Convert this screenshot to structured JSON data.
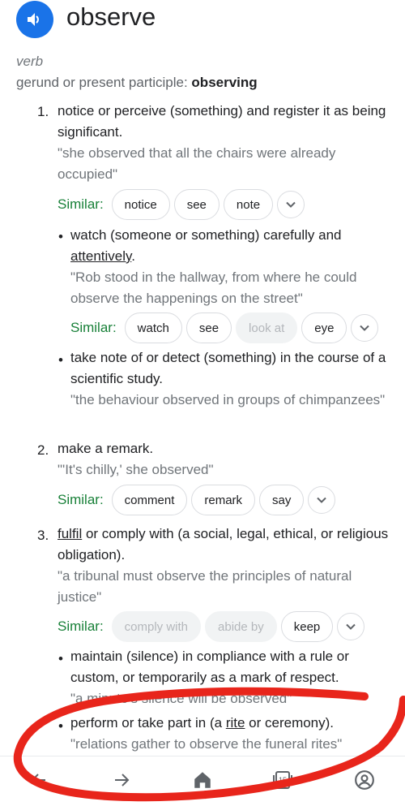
{
  "header": {
    "word": "observe",
    "speaker_icon": "volume-icon",
    "accent": "#1a73e8"
  },
  "pos": "verb",
  "gerund": {
    "label": "gerund or present participle:",
    "form": "observing"
  },
  "senses": [
    {
      "number": "1.",
      "definition": "notice or perceive (something) and register it as being significant.",
      "example": "\"she observed that all the chairs were already occupied\"",
      "similar": [
        "notice",
        "see",
        "note"
      ],
      "subs": [
        {
          "definition_pre": "watch (someone or something) carefully and ",
          "definition_link": "attentively",
          "definition_post": ".",
          "example": "\"Rob stood in the hallway, from where he could observe the happenings on the street\"",
          "similar": [
            "watch",
            "see",
            "look at",
            "eye"
          ]
        },
        {
          "definition": "take note of or detect (something) in the course of a scientific study.",
          "example": "\"the behaviour observed in groups of chimpanzees\""
        }
      ]
    },
    {
      "number": "2.",
      "definition": "make a remark.",
      "example": "\"'It's chilly,' she observed\"",
      "similar": [
        "comment",
        "remark",
        "say"
      ]
    },
    {
      "number": "3.",
      "definition_link": "fulfil",
      "definition_post": " or comply with (a social, legal, ethical, or religious obligation).",
      "example": "\"a tribunal must observe the principles of natural justice\"",
      "similar": [
        "comply with",
        "abide by",
        "keep"
      ],
      "subs": [
        {
          "definition": "maintain (silence) in compliance with a rule or custom, or temporarily as a mark of respect.",
          "example": "\"a minute's silence will be observed\""
        },
        {
          "definition_pre": "perform or take part in (a ",
          "definition_link": "rite",
          "definition_post": " or ceremony).",
          "example": "\"relations gather to observe the funeral rites\""
        }
      ]
    }
  ],
  "similar_label": "Similar:",
  "nav": {
    "tab_count": "15"
  },
  "colors": {
    "similar_label": "#188038",
    "annotation": "#e8251b"
  }
}
